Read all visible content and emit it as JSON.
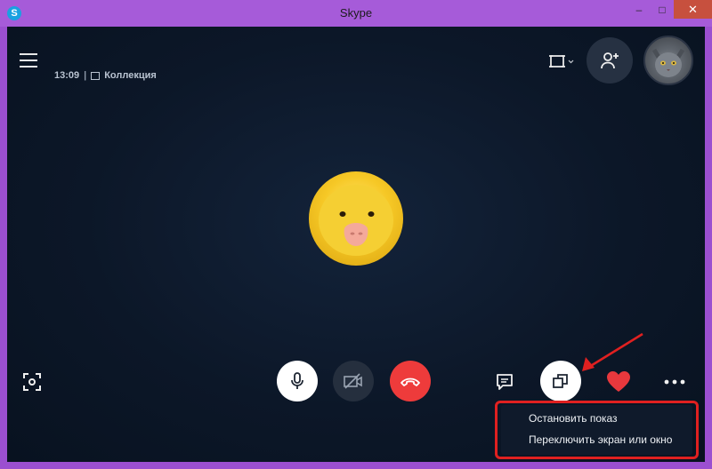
{
  "window": {
    "title": "Skype",
    "app_icon_letter": "S"
  },
  "window_controls": {
    "minimize": "–",
    "maximize": "□",
    "close": "✕"
  },
  "call": {
    "time": "13:09",
    "separator": "|",
    "collection_label": "Коллекция"
  },
  "icons": {
    "menu": "hamburger-icon",
    "screen": "screen-select-icon",
    "add_person": "add-person-icon",
    "fullscreen": "fullscreen-icon",
    "mic": "microphone-icon",
    "camera": "camera-off-icon",
    "hangup": "hangup-icon",
    "chat": "chat-icon",
    "share": "screen-share-icon",
    "heart": "heart-icon",
    "more": "more-icon"
  },
  "colors": {
    "titlebar": "#a65bd9",
    "call_bg": "#0c1728",
    "hangup": "#ee3b3b",
    "heart": "#e8383d",
    "annotation": "#e02020"
  },
  "share_menu": {
    "items": [
      {
        "label": "Остановить показ"
      },
      {
        "label": "Переключить экран или окно"
      }
    ]
  }
}
